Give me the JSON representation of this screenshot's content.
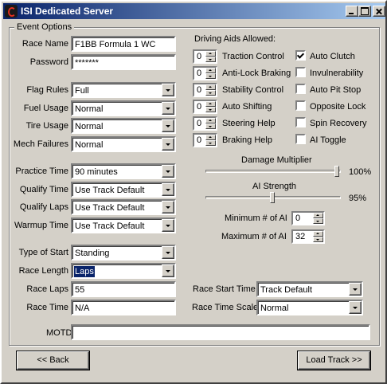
{
  "window": {
    "title": "ISI Dedicated Server"
  },
  "group": {
    "label": "Event Options"
  },
  "race_name": {
    "label": "Race Name",
    "value": "F1BB Formula 1 WC"
  },
  "password": {
    "label": "Password",
    "value": "*******"
  },
  "flag_rules": {
    "label": "Flag Rules",
    "value": "Full"
  },
  "fuel_usage": {
    "label": "Fuel Usage",
    "value": "Normal"
  },
  "tire_usage": {
    "label": "Tire Usage",
    "value": "Normal"
  },
  "mech_failures": {
    "label": "Mech Failures",
    "value": "Normal"
  },
  "practice_time": {
    "label": "Practice Time",
    "value": "90 minutes"
  },
  "qualify_time": {
    "label": "Qualify Time",
    "value": "Use Track Default"
  },
  "qualify_laps": {
    "label": "Qualify Laps",
    "value": "Use Track Default"
  },
  "warmup_time": {
    "label": "Warmup Time",
    "value": "Use Track Default"
  },
  "type_of_start": {
    "label": "Type of Start",
    "value": "Standing"
  },
  "race_length": {
    "label": "Race Length",
    "value": "Laps"
  },
  "race_laps": {
    "label": "Race Laps",
    "value": "55"
  },
  "race_time": {
    "label": "Race Time",
    "value": "N/A"
  },
  "driving_aids": {
    "header": "Driving Aids Allowed:",
    "levels": [
      {
        "label": "Traction Control",
        "value": "0"
      },
      {
        "label": "Anti-Lock Braking",
        "value": "0"
      },
      {
        "label": "Stability Control",
        "value": "0"
      },
      {
        "label": "Auto Shifting",
        "value": "0"
      },
      {
        "label": "Steering Help",
        "value": "0"
      },
      {
        "label": "Braking Help",
        "value": "0"
      }
    ],
    "toggles": [
      {
        "label": "Auto Clutch",
        "checked": true
      },
      {
        "label": "Invulnerability",
        "checked": false
      },
      {
        "label": "Auto Pit Stop",
        "checked": false
      },
      {
        "label": "Opposite Lock",
        "checked": false
      },
      {
        "label": "Spin Recovery",
        "checked": false
      },
      {
        "label": "AI Toggle",
        "checked": false
      }
    ]
  },
  "damage_multiplier": {
    "label": "Damage Multiplier",
    "value_text": "100%",
    "level": 1.0
  },
  "ai_strength": {
    "label": "AI Strength",
    "value_text": "95%",
    "level": 0.5
  },
  "min_ai": {
    "label": "Minimum # of AI",
    "value": "0"
  },
  "max_ai": {
    "label": "Maximum # of AI",
    "value": "32"
  },
  "race_start_time": {
    "label": "Race Start Time",
    "value": "Track Default"
  },
  "race_time_scale": {
    "label": "Race Time Scale",
    "value": "Normal"
  },
  "motd": {
    "label": "MOTD",
    "value": ""
  },
  "buttons": {
    "back": "<< Back",
    "load_track": "Load Track >>"
  }
}
